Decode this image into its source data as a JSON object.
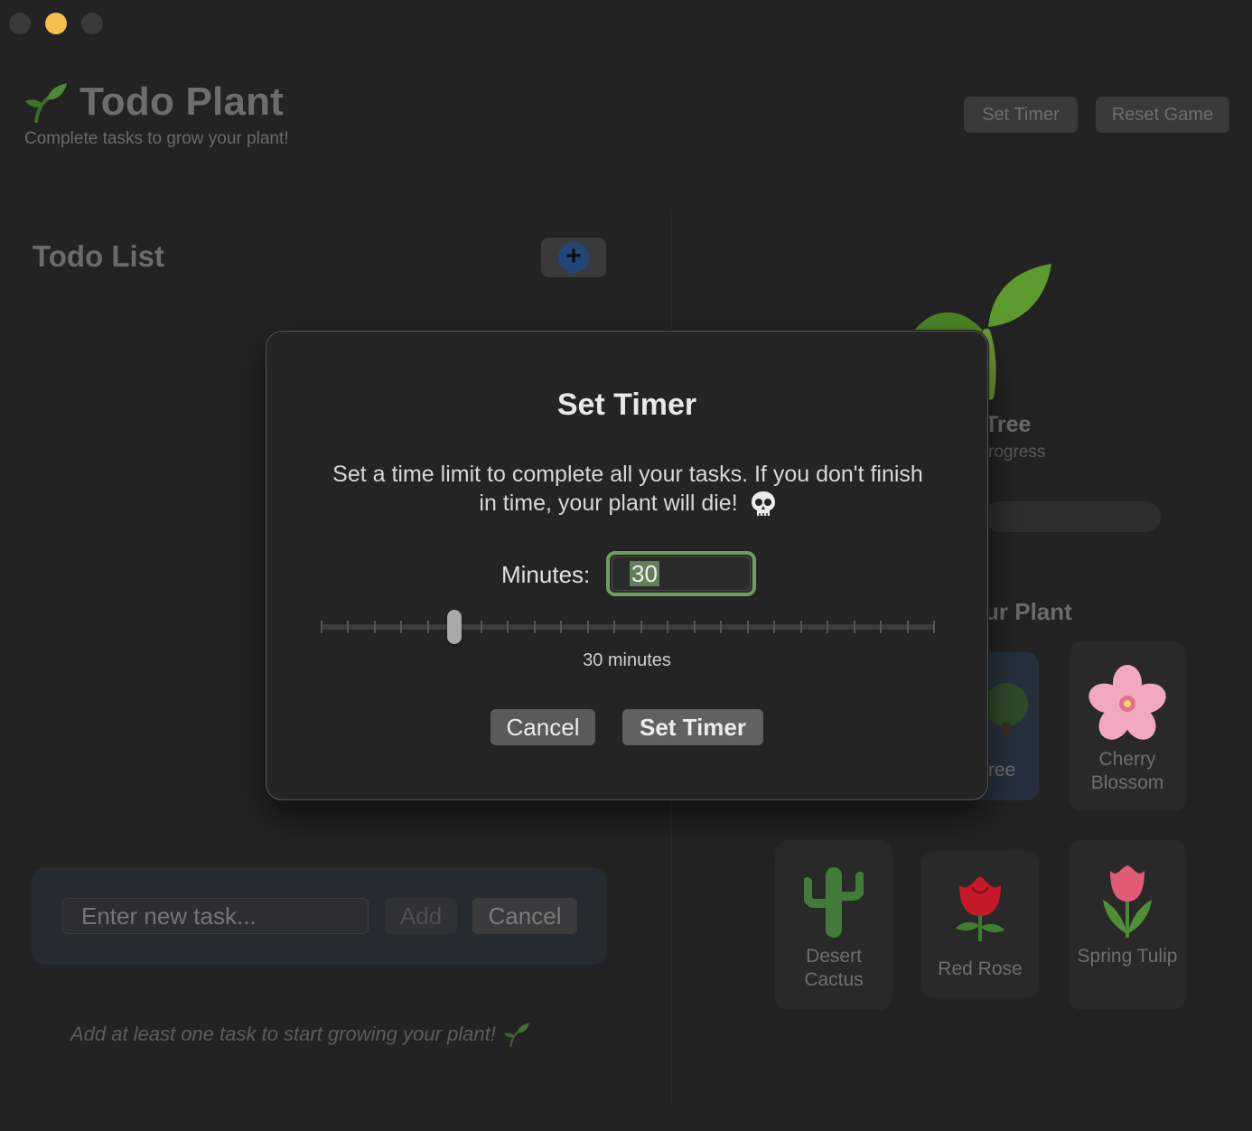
{
  "window": {
    "traffic_lights": [
      "close",
      "minimize",
      "zoom"
    ]
  },
  "header": {
    "title": "Todo Plant",
    "subtitle": "Complete tasks to grow your plant!",
    "set_timer_label": "Set Timer",
    "reset_game_label": "Reset Game"
  },
  "todo": {
    "title": "Todo List",
    "add_icon": "+",
    "input_placeholder": "Enter new task...",
    "add_label": "Add",
    "cancel_label": "Cancel",
    "hint": "Add at least one task to start growing your plant!"
  },
  "plant": {
    "name_partial": "Tree",
    "progress_partial": "rogress",
    "choose_title_partial": "ur Plant",
    "options": [
      {
        "label": "Tree",
        "icon": "tree-icon",
        "selected": true
      },
      {
        "label": "Cherry Blossom",
        "icon": "cherry-blossom-icon",
        "selected": false
      },
      {
        "label": "Desert Cactus",
        "icon": "cactus-icon",
        "selected": false
      },
      {
        "label": "Red Rose",
        "icon": "rose-icon",
        "selected": false
      },
      {
        "label": "Spring Tulip",
        "icon": "tulip-icon",
        "selected": false
      }
    ]
  },
  "modal": {
    "title": "Set Timer",
    "description": "Set a time limit to complete all your tasks. If you don't finish in time, your plant will die!",
    "minutes_label": "Minutes:",
    "minutes_value": "30",
    "slider_value_minutes": 30,
    "slider_readout": "30 minutes",
    "cancel_label": "Cancel",
    "set_label": "Set Timer"
  },
  "colors": {
    "accent_green": "#6aa05b",
    "selection_green": "#5f7f57",
    "traffic_yellow": "#f6bf4f",
    "add_button_blue": "#22467a"
  }
}
